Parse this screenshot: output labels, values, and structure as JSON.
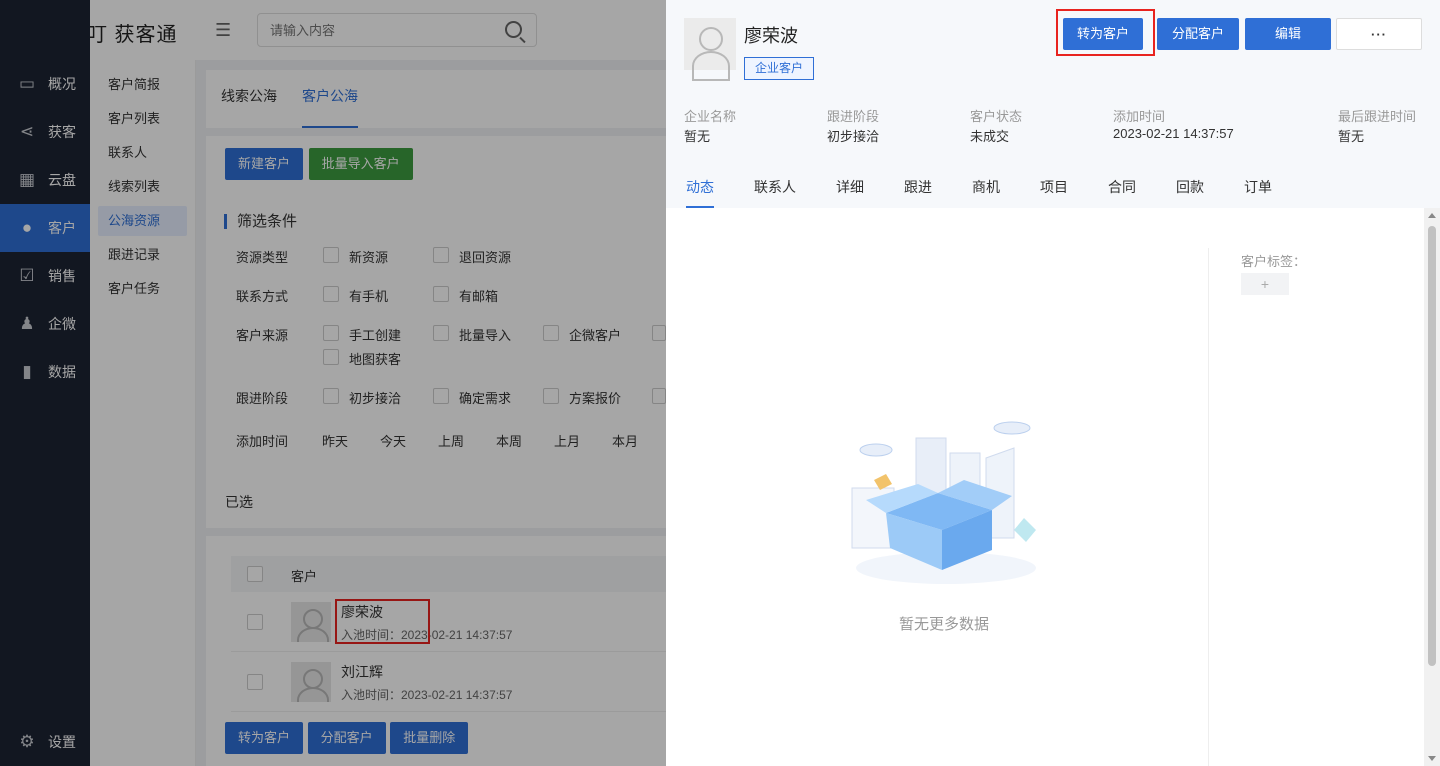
{
  "app": {
    "logo_text": "快叮 获客通",
    "search_placeholder": "请输入内容"
  },
  "nav": {
    "items": [
      {
        "label": "概况",
        "icon": "monitor-icon"
      },
      {
        "label": "获客",
        "icon": "share-icon"
      },
      {
        "label": "云盘",
        "icon": "grid-icon"
      },
      {
        "label": "客户",
        "icon": "user-icon",
        "active": true
      },
      {
        "label": "销售",
        "icon": "clipboard-icon"
      },
      {
        "label": "企微",
        "icon": "person-icon"
      },
      {
        "label": "数据",
        "icon": "bar-chart-icon"
      }
    ],
    "settings_label": "设置"
  },
  "subnav": {
    "items": [
      "客户简报",
      "客户列表",
      "联系人",
      "线索列表",
      "公海资源",
      "跟进记录",
      "客户任务"
    ],
    "active_index": 4
  },
  "main": {
    "tabs": [
      "线索公海",
      "客户公海"
    ],
    "active_tab": 1,
    "buttons": {
      "new": "新建客户",
      "import": "批量导入客户"
    },
    "filter_title": "筛选条件",
    "filters": {
      "resource_type": {
        "label": "资源类型",
        "options": [
          "新资源",
          "退回资源"
        ]
      },
      "contact": {
        "label": "联系方式",
        "options": [
          "有手机",
          "有邮箱"
        ]
      },
      "source": {
        "label": "客户来源",
        "options": [
          "手工创建",
          "批量导入",
          "企微客户",
          "地图获客"
        ]
      },
      "stage": {
        "label": "跟进阶段",
        "options": [
          "初步接洽",
          "确定需求",
          "方案报价"
        ]
      },
      "date": {
        "label": "添加时间",
        "options": [
          "昨天",
          "今天",
          "上周",
          "本周",
          "上月",
          "本月"
        ]
      }
    },
    "selected_label": "已选",
    "table": {
      "header": "客户",
      "rows": [
        {
          "name": "廖荣波",
          "meta": "入池时间：2023-02-21 14:37:57"
        },
        {
          "name": "刘江辉",
          "meta": "入池时间：2023-02-21 14:37:57"
        }
      ]
    },
    "bottom_buttons": {
      "convert": "转为客户",
      "assign": "分配客户",
      "delete": "批量删除"
    }
  },
  "drawer": {
    "name": "廖荣波",
    "tag": "企业客户",
    "buttons": {
      "convert": "转为客户",
      "assign": "分配客户",
      "edit": "编辑",
      "more": "···"
    },
    "info": [
      {
        "label": "企业名称",
        "value": "暂无"
      },
      {
        "label": "跟进阶段",
        "value": "初步接洽"
      },
      {
        "label": "客户状态",
        "value": "未成交"
      },
      {
        "label": "添加时间",
        "value": "2023-02-21 14:37:57"
      },
      {
        "label": "最后跟进时间",
        "value": "暂无"
      }
    ],
    "tabs": [
      "动态",
      "联系人",
      "详细",
      "跟进",
      "商机",
      "项目",
      "合同",
      "回款",
      "订单"
    ],
    "active_tab": 0,
    "tag_title": "客户标签：",
    "tag_add": "+",
    "empty_text": "暂无更多数据"
  },
  "colors": {
    "accent": "#2f6fd6",
    "highlight": "#e8231f",
    "nav_bg": "#1d2433",
    "green": "#3d9b3f"
  }
}
